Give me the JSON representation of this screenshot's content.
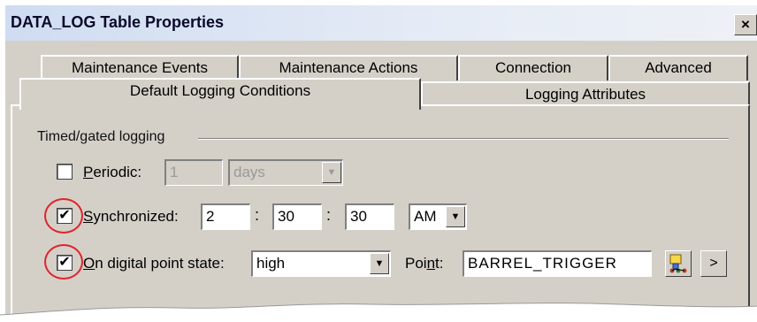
{
  "window": {
    "title": "DATA_LOG Table Properties",
    "close_glyph": "×"
  },
  "tabs": [
    {
      "label": "Maintenance Events"
    },
    {
      "label": "Maintenance Actions"
    },
    {
      "label": "Connection"
    },
    {
      "label": "Advanced"
    },
    {
      "label": "Default Logging Conditions"
    },
    {
      "label": "Logging Attributes"
    }
  ],
  "group": {
    "label": "Timed/gated logging"
  },
  "periodic": {
    "label_u": "P",
    "label_rest": "eriodic:",
    "checked": false,
    "value": "1",
    "unit": "days"
  },
  "synchronized": {
    "label_u": "S",
    "label_rest": "ynchronized:",
    "checked": true,
    "hour": "2",
    "minute": "30",
    "second": "30",
    "ampm": "AM",
    "sep": ":"
  },
  "digital": {
    "label_u": "O",
    "label_rest": "n digital point state:",
    "checked": true,
    "state": "high",
    "point_label_pre": "Poi",
    "point_label_u": "n",
    "point_label_post": "t:",
    "point_value": "BARREL_TRIGGER"
  },
  "buttons": {
    "more": ">"
  },
  "check_glyph": "✔",
  "dropdown_glyph": "▼",
  "colors": {
    "highlight": "#e0232b",
    "face": "#d4d0c8"
  }
}
